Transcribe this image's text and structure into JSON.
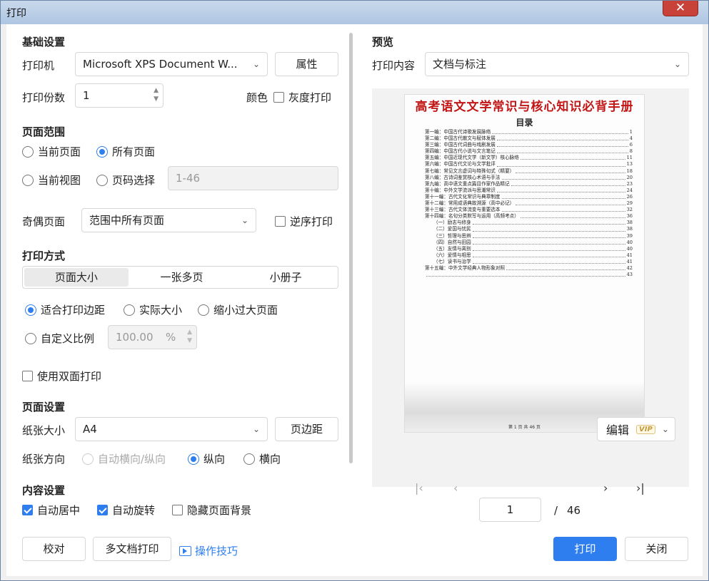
{
  "window": {
    "title": "打印",
    "close_label": "✕"
  },
  "basic": {
    "heading": "基础设置",
    "printer_label": "打印机",
    "printer_value": "Microsoft XPS Document W...",
    "properties_button": "属性",
    "copies_label": "打印份数",
    "copies_value": "1",
    "color_label": "颜色",
    "grayscale_label": "灰度打印"
  },
  "page_range": {
    "heading": "页面范围",
    "current_page": "当前页面",
    "all_pages": "所有页面",
    "current_view": "当前视图",
    "page_select": "页码选择",
    "page_select_placeholder": "1-46",
    "odd_even_label": "奇偶页面",
    "odd_even_value": "范围中所有页面",
    "reverse_label": "逆序打印"
  },
  "print_mode": {
    "heading": "打印方式",
    "tabs": [
      "页面大小",
      "一张多页",
      "小册子"
    ],
    "fit_margin": "适合打印边距",
    "actual_size": "实际大小",
    "shrink_large": "缩小过大页面",
    "custom_scale": "自定义比例",
    "scale_value": "100.00",
    "scale_unit": "%",
    "duplex_label": "使用双面打印"
  },
  "page_setup": {
    "heading": "页面设置",
    "paper_label": "纸张大小",
    "paper_value": "A4",
    "margin_button": "页边距",
    "orientation_label": "纸张方向",
    "auto_orientation": "自动横向/纵向",
    "portrait": "纵向",
    "landscape": "横向"
  },
  "content": {
    "heading": "内容设置",
    "auto_center": "自动居中",
    "auto_rotate": "自动旋转",
    "hide_bg": "隐藏页面背景"
  },
  "footer": {
    "proof_button": "校对",
    "multi_doc_button": "多文档打印",
    "tips_link": "操作技巧",
    "print_button": "打印",
    "close_button": "关闭"
  },
  "preview": {
    "heading": "预览",
    "content_label": "打印内容",
    "content_value": "文档与标注",
    "edit_label": "编辑",
    "vip": "VIP",
    "page_current": "1",
    "page_sep": "/",
    "page_total": "46",
    "doc_title": "高考语文文学常识与核心知识必背手册",
    "toc_heading": "目录",
    "page_footer": "第 1 页 共 46 页",
    "toc": [
      {
        "t": "第一编：中国古代诗歌发展脉络",
        "p": "1",
        "sub": false
      },
      {
        "t": "第二编：中国古代散文与赋体发展",
        "p": "4",
        "sub": false
      },
      {
        "t": "第三编：中国古代词曲与戏剧发展",
        "p": "6",
        "sub": false
      },
      {
        "t": "第四编：中国古代小说与文言笔记",
        "p": "8",
        "sub": false
      },
      {
        "t": "第五编：中国近现代文学（新文学）核心脉络",
        "p": "11",
        "sub": false
      },
      {
        "t": "第六编：中国古代文论与文学批评",
        "p": "13",
        "sub": false
      },
      {
        "t": "第七编：常见文言虚词与特殊句式（精要）",
        "p": "18",
        "sub": false
      },
      {
        "t": "第八编：古诗词鉴赏核心术语与手法",
        "p": "20",
        "sub": false
      },
      {
        "t": "第九编：高中语文重点篇目作家作品精记",
        "p": "23",
        "sub": false
      },
      {
        "t": "第十编：中外文学流派与思潮常识",
        "p": "24",
        "sub": false
      },
      {
        "t": "第十一编：古代文化常识与典章制度",
        "p": "26",
        "sub": false
      },
      {
        "t": "第十二编：常用成语典故溯源（高中必记）",
        "p": "29",
        "sub": false
      },
      {
        "t": "第十三编：古代文体流变与重要选本",
        "p": "32",
        "sub": false
      },
      {
        "t": "第十四编：名句分类默写与运用（高频考点）",
        "p": "36",
        "sub": false
      },
      {
        "t": "（一）励志与修身",
        "p": "38",
        "sub": true
      },
      {
        "t": "（二）爱国与忧民",
        "p": "38",
        "sub": true
      },
      {
        "t": "（三）哲理与思辨",
        "p": "39",
        "sub": true
      },
      {
        "t": "（四）自然与田园",
        "p": "40",
        "sub": true
      },
      {
        "t": "（五）友情与离别",
        "p": "40",
        "sub": true
      },
      {
        "t": "（六）爱情与相思",
        "p": "41",
        "sub": true
      },
      {
        "t": "（七）读书与治学",
        "p": "41",
        "sub": true
      },
      {
        "t": "第十五编：中外文学经典人物形象对照",
        "p": "42",
        "sub": false
      },
      {
        "t": "",
        "p": "43",
        "sub": false
      }
    ]
  }
}
